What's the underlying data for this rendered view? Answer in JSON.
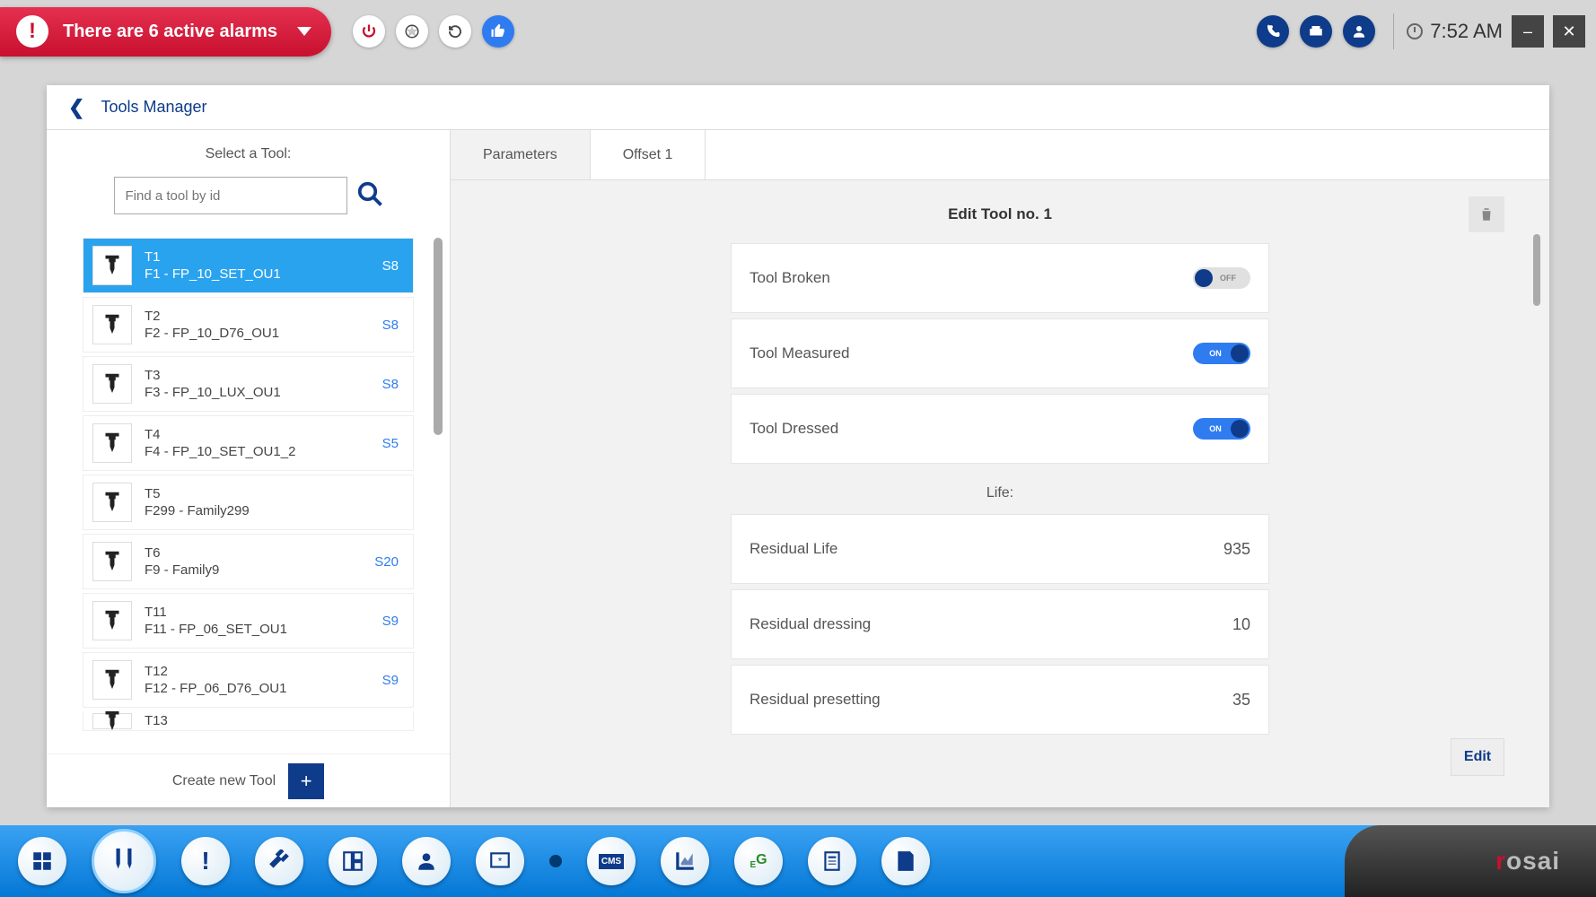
{
  "topbar": {
    "alarm_text": "There are 6 active alarms",
    "time": "7:52 AM"
  },
  "main": {
    "title": "Tools Manager"
  },
  "sidebar": {
    "select_label": "Select a Tool:",
    "search_placeholder": "Find a tool by id",
    "create_label": "Create new Tool",
    "tools": [
      {
        "id": "T1",
        "family": "F1 - FP_10_SET_OU1",
        "badge": "S8",
        "selected": true
      },
      {
        "id": "T2",
        "family": "F2 - FP_10_D76_OU1",
        "badge": "S8",
        "selected": false
      },
      {
        "id": "T3",
        "family": "F3 - FP_10_LUX_OU1",
        "badge": "S8",
        "selected": false
      },
      {
        "id": "T4",
        "family": "F4 - FP_10_SET_OU1_2",
        "badge": "S5",
        "selected": false
      },
      {
        "id": "T5",
        "family": "F299 - Family299",
        "badge": "",
        "selected": false
      },
      {
        "id": "T6",
        "family": "F9 - Family9",
        "badge": "S20",
        "selected": false
      },
      {
        "id": "T11",
        "family": "F11 - FP_06_SET_OU1",
        "badge": "S9",
        "selected": false
      },
      {
        "id": "T12",
        "family": "F12 - FP_06_D76_OU1",
        "badge": "S9",
        "selected": false
      },
      {
        "id": "T13",
        "family": "",
        "badge": "",
        "selected": false
      }
    ]
  },
  "tabs": {
    "t0": "Parameters",
    "t1": "Offset 1"
  },
  "detail": {
    "title": "Edit Tool no. 1",
    "params": {
      "broken_label": "Tool Broken",
      "broken_state": "OFF",
      "measured_label": "Tool Measured",
      "measured_state": "ON",
      "dressed_label": "Tool Dressed",
      "dressed_state": "ON"
    },
    "life_label": "Life:",
    "life": {
      "residual_life_label": "Residual Life",
      "residual_life_value": "935",
      "residual_dressing_label": "Residual dressing",
      "residual_dressing_value": "10",
      "residual_presetting_label": "Residual presetting",
      "residual_presetting_value": "35"
    },
    "edit_label": "Edit"
  },
  "brand": {
    "pre": "r",
    "rest": "osai"
  }
}
